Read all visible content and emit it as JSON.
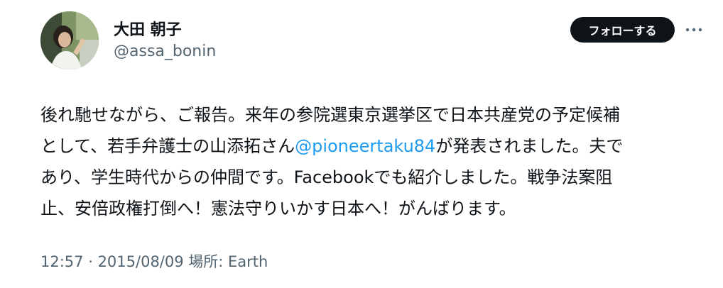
{
  "user": {
    "display_name": "大田 朝子",
    "handle": "@assa_bonin"
  },
  "actions": {
    "follow_label": "フォローする",
    "more_icon": "more-horizontal-icon"
  },
  "tweet": {
    "line1": "後れ馳せながら、ご報告。来年の参院選東京選挙区で日本共産党の予定候補",
    "line2_before": "として、若手弁護士の山添拓さん",
    "line2_mention": "@pioneertaku84",
    "line2_after": "が発表されました。夫で",
    "line3": "あり、学生時代からの仲間です。Facebookでも紹介しました。戦争法案阻",
    "line4": "止、安倍政権打倒へ！憲法守りいかす日本へ！がんばります。"
  },
  "meta": {
    "time": "12:57",
    "separator": " · ",
    "date": "2015/08/09",
    "location": " 場所: Earth"
  },
  "colors": {
    "text": "#0f1419",
    "secondary": "#536471",
    "link": "#1d9bf0",
    "button_bg": "#0f1419"
  }
}
